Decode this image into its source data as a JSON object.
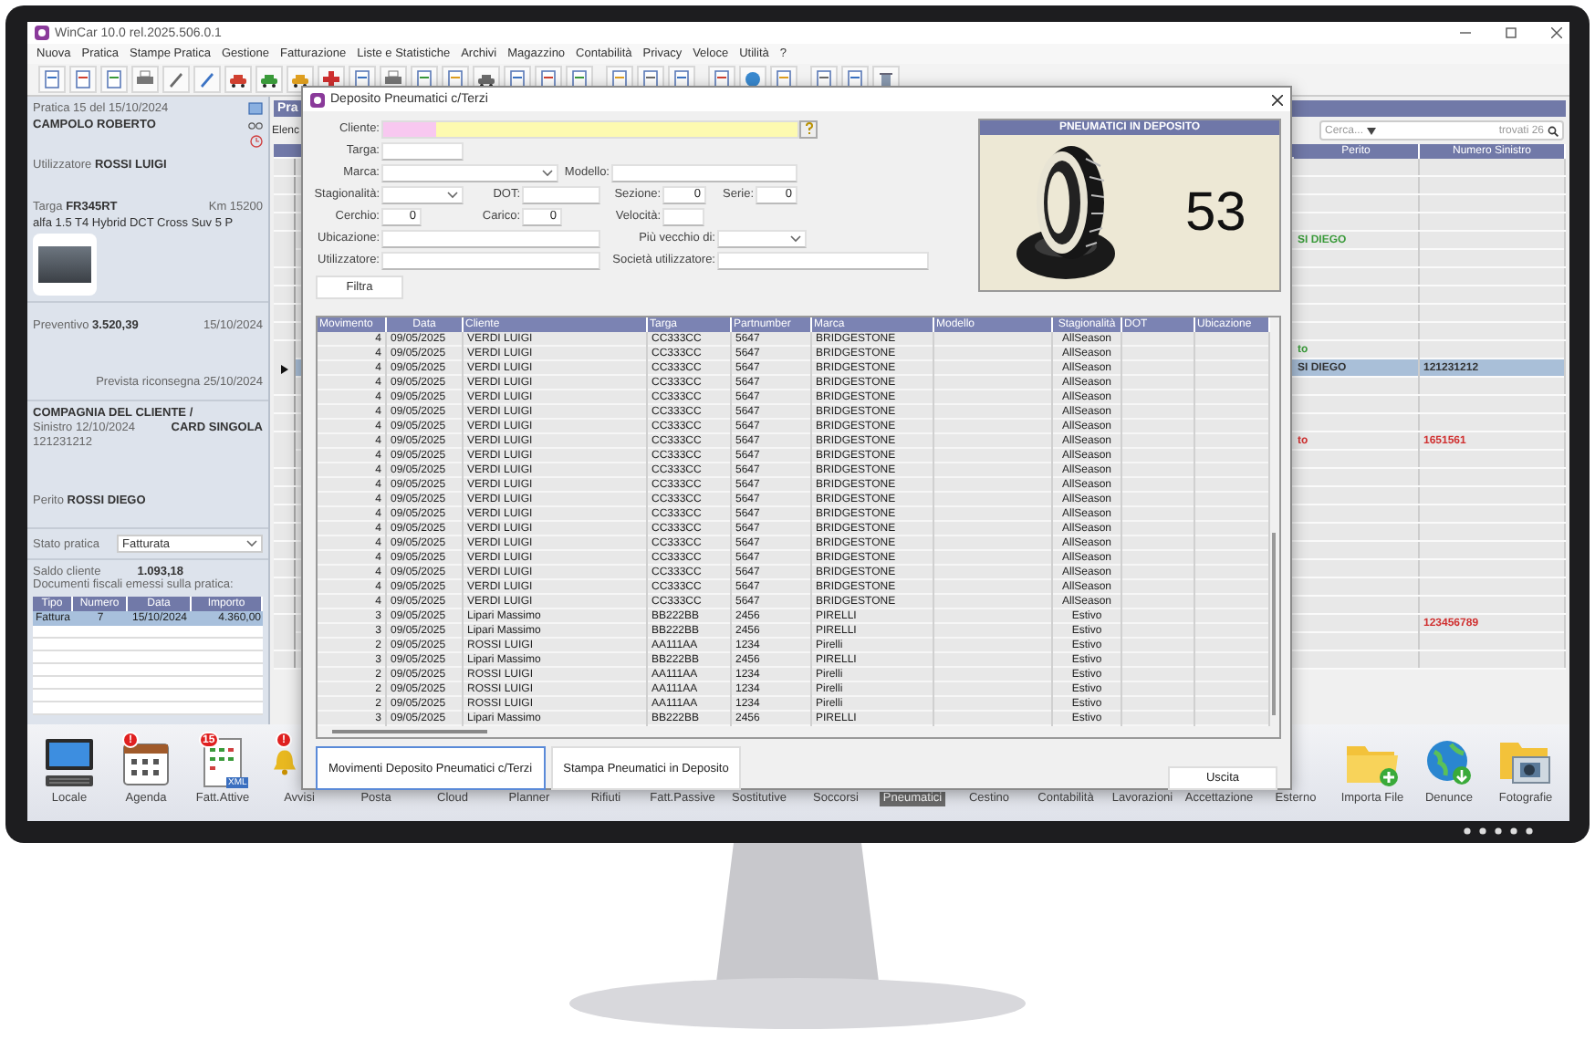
{
  "app": {
    "title": "WinCar 10.0 rel.2025.506.0.1",
    "menu": [
      "Nuova",
      "Pratica",
      "Stampe Pratica",
      "Gestione",
      "Fatturazione",
      "Liste e Statistiche",
      "Archivi",
      "Magazzino",
      "Contabilità",
      "Privacy",
      "Veloce",
      "Utilità",
      "?"
    ]
  },
  "practice_panel": {
    "header": "Pratica 15 del 15/10/2024",
    "customer": "CAMPOLO ROBERTO",
    "user": "Utilizzatore **ROSSI LUIGI**",
    "plate": "Targa **FR345RT**",
    "km": "Km 15200",
    "vehicle": "alfa 1.5 T4 Hybrid DCT Cross Suv 5 P",
    "estimate": "Preventivo **3.520,39**",
    "estimate_date": "15/10/2024",
    "delivery": "Prevista riconsegna 25/10/2024",
    "insurer": "COMPAGNIA DEL CLIENTE /",
    "claim": "Sinistro 12/10/2024",
    "claim_type": "CARD SINGOLA",
    "claim_number": "121231212",
    "assessor": "Perito **ROSSI DIEGO**",
    "status_label": "Stato pratica",
    "status_value": "Fatturata",
    "balance_label": "Saldo cliente",
    "balance": "1.093,18",
    "documents_title": "Documenti fiscali emessi sulla pratica:",
    "documents": {
      "columns": [
        "Tipo",
        "Numero",
        "Data",
        "Importo"
      ],
      "rows": [
        {
          "cells": [
            "Fattura",
            "7",
            "15/10/2024",
            "4.360,00"
          ],
          "selected": true
        }
      ]
    }
  },
  "list_panel": {
    "title": "Pra",
    "tab": "Elenc",
    "search": {
      "placeholder": "Cerca...",
      "count": "trovati 26"
    },
    "columns": [
      "Perito",
      "Numero Sinistro"
    ],
    "rows": [
      {
        "selected": false
      },
      {
        "selected": false
      },
      {
        "selected": false
      },
      {
        "selected": false
      },
      {
        "selected": false,
        "perito": "SI DIEGO",
        "color": "#3a9a3a"
      },
      {
        "selected": false
      },
      {
        "selected": false
      },
      {
        "selected": false
      },
      {
        "selected": false
      },
      {
        "selected": false
      },
      {
        "selected": false,
        "perito": "to",
        "color": "#3a9a3a"
      },
      {
        "selected": true,
        "perito": "SI DIEGO",
        "numero_sinistro": "121231212"
      },
      {
        "selected": false
      },
      {
        "selected": false
      },
      {
        "selected": false
      },
      {
        "selected": false,
        "perito": "to",
        "numero_sinistro": "1651561",
        "color": "#d03030"
      },
      {
        "selected": false
      },
      {
        "selected": false
      },
      {
        "selected": false
      },
      {
        "selected": false
      },
      {
        "selected": false
      },
      {
        "selected": false
      },
      {
        "selected": false
      },
      {
        "selected": false
      },
      {
        "selected": false
      },
      {
        "selected": false,
        "numero_sinistro": "123456789",
        "color": "#d03030"
      },
      {
        "selected": false
      },
      {
        "selected": false
      }
    ]
  },
  "dialog": {
    "title": "Deposito Pneumatici c/Terzi",
    "filters": [
      [
        {
          "label": "Cliente:",
          "kind": "lookup"
        }
      ],
      [
        {
          "label": "Targa:",
          "kind": "text"
        }
      ],
      [
        {
          "label": "Marca:",
          "kind": "select"
        },
        {
          "label": "Modello:",
          "kind": "text"
        }
      ],
      [
        {
          "label": "Stagionalità:",
          "kind": "select"
        },
        {
          "label": "DOT:",
          "kind": "text"
        },
        {
          "label": "Sezione:",
          "kind": "number",
          "value": "0"
        },
        {
          "label": "Serie:",
          "kind": "number",
          "value": "0"
        }
      ],
      [
        {
          "label": "Cerchio:",
          "kind": "number",
          "value": "0"
        },
        {
          "label": "Carico:",
          "kind": "number",
          "value": "0"
        },
        {
          "label": "Velocità:",
          "kind": "text"
        }
      ],
      [
        {
          "label": "Ubicazione:",
          "kind": "text"
        },
        {
          "label": "Più vecchio di:",
          "kind": "select"
        }
      ],
      [
        {
          "label": "Utilizzatore:",
          "kind": "text"
        },
        {
          "label": "Società utilizzatore:",
          "kind": "text"
        }
      ]
    ],
    "filter_button": "Filtra",
    "stock": {
      "title": "PNEUMATICI IN DEPOSITO",
      "count": "53"
    },
    "table": {
      "columns": [
        "Movimento",
        "Data",
        "Cliente",
        "Targa",
        "Partnumber",
        "Marca",
        "Modello",
        "Stagionalità",
        "DOT",
        "Ubicazione"
      ],
      "rows": [
        {
          "movimento": "4",
          "data": "09/05/2025",
          "cliente": "VERDI LUIGI",
          "targa": "CC333CC",
          "partnumber": "5647",
          "marca": "BRIDGESTONE",
          "stagionalita": "AllSeason"
        },
        {
          "movimento": "4",
          "data": "09/05/2025",
          "cliente": "VERDI LUIGI",
          "targa": "CC333CC",
          "partnumber": "5647",
          "marca": "BRIDGESTONE",
          "stagionalita": "AllSeason"
        },
        {
          "movimento": "4",
          "data": "09/05/2025",
          "cliente": "VERDI LUIGI",
          "targa": "CC333CC",
          "partnumber": "5647",
          "marca": "BRIDGESTONE",
          "stagionalita": "AllSeason"
        },
        {
          "movimento": "4",
          "data": "09/05/2025",
          "cliente": "VERDI LUIGI",
          "targa": "CC333CC",
          "partnumber": "5647",
          "marca": "BRIDGESTONE",
          "stagionalita": "AllSeason"
        },
        {
          "movimento": "4",
          "data": "09/05/2025",
          "cliente": "VERDI LUIGI",
          "targa": "CC333CC",
          "partnumber": "5647",
          "marca": "BRIDGESTONE",
          "stagionalita": "AllSeason"
        },
        {
          "movimento": "4",
          "data": "09/05/2025",
          "cliente": "VERDI LUIGI",
          "targa": "CC333CC",
          "partnumber": "5647",
          "marca": "BRIDGESTONE",
          "stagionalita": "AllSeason"
        },
        {
          "movimento": "4",
          "data": "09/05/2025",
          "cliente": "VERDI LUIGI",
          "targa": "CC333CC",
          "partnumber": "5647",
          "marca": "BRIDGESTONE",
          "stagionalita": "AllSeason"
        },
        {
          "movimento": "4",
          "data": "09/05/2025",
          "cliente": "VERDI LUIGI",
          "targa": "CC333CC",
          "partnumber": "5647",
          "marca": "BRIDGESTONE",
          "stagionalita": "AllSeason"
        },
        {
          "movimento": "4",
          "data": "09/05/2025",
          "cliente": "VERDI LUIGI",
          "targa": "CC333CC",
          "partnumber": "5647",
          "marca": "BRIDGESTONE",
          "stagionalita": "AllSeason"
        },
        {
          "movimento": "4",
          "data": "09/05/2025",
          "cliente": "VERDI LUIGI",
          "targa": "CC333CC",
          "partnumber": "5647",
          "marca": "BRIDGESTONE",
          "stagionalita": "AllSeason"
        },
        {
          "movimento": "4",
          "data": "09/05/2025",
          "cliente": "VERDI LUIGI",
          "targa": "CC333CC",
          "partnumber": "5647",
          "marca": "BRIDGESTONE",
          "stagionalita": "AllSeason"
        },
        {
          "movimento": "4",
          "data": "09/05/2025",
          "cliente": "VERDI LUIGI",
          "targa": "CC333CC",
          "partnumber": "5647",
          "marca": "BRIDGESTONE",
          "stagionalita": "AllSeason"
        },
        {
          "movimento": "4",
          "data": "09/05/2025",
          "cliente": "VERDI LUIGI",
          "targa": "CC333CC",
          "partnumber": "5647",
          "marca": "BRIDGESTONE",
          "stagionalita": "AllSeason"
        },
        {
          "movimento": "4",
          "data": "09/05/2025",
          "cliente": "VERDI LUIGI",
          "targa": "CC333CC",
          "partnumber": "5647",
          "marca": "BRIDGESTONE",
          "stagionalita": "AllSeason"
        },
        {
          "movimento": "4",
          "data": "09/05/2025",
          "cliente": "VERDI LUIGI",
          "targa": "CC333CC",
          "partnumber": "5647",
          "marca": "BRIDGESTONE",
          "stagionalita": "AllSeason"
        },
        {
          "movimento": "4",
          "data": "09/05/2025",
          "cliente": "VERDI LUIGI",
          "targa": "CC333CC",
          "partnumber": "5647",
          "marca": "BRIDGESTONE",
          "stagionalita": "AllSeason"
        },
        {
          "movimento": "4",
          "data": "09/05/2025",
          "cliente": "VERDI LUIGI",
          "targa": "CC333CC",
          "partnumber": "5647",
          "marca": "BRIDGESTONE",
          "stagionalita": "AllSeason"
        },
        {
          "movimento": "4",
          "data": "09/05/2025",
          "cliente": "VERDI LUIGI",
          "targa": "CC333CC",
          "partnumber": "5647",
          "marca": "BRIDGESTONE",
          "stagionalita": "AllSeason"
        },
        {
          "movimento": "4",
          "data": "09/05/2025",
          "cliente": "VERDI LUIGI",
          "targa": "CC333CC",
          "partnumber": "5647",
          "marca": "BRIDGESTONE",
          "stagionalita": "AllSeason"
        },
        {
          "movimento": "3",
          "data": "09/05/2025",
          "cliente": "Lipari Massimo",
          "targa": "BB222BB",
          "partnumber": "2456",
          "marca": "PIRELLI",
          "stagionalita": "Estivo"
        },
        {
          "movimento": "3",
          "data": "09/05/2025",
          "cliente": "Lipari Massimo",
          "targa": "BB222BB",
          "partnumber": "2456",
          "marca": "PIRELLI",
          "stagionalita": "Estivo"
        },
        {
          "movimento": "2",
          "data": "09/05/2025",
          "cliente": "ROSSI LUIGI",
          "targa": "AA111AA",
          "partnumber": "1234",
          "marca": "Pirelli",
          "stagionalita": "Estivo"
        },
        {
          "movimento": "3",
          "data": "09/05/2025",
          "cliente": "Lipari Massimo",
          "targa": "BB222BB",
          "partnumber": "2456",
          "marca": "PIRELLI",
          "stagionalita": "Estivo"
        },
        {
          "movimento": "2",
          "data": "09/05/2025",
          "cliente": "ROSSI LUIGI",
          "targa": "AA111AA",
          "partnumber": "1234",
          "marca": "Pirelli",
          "stagionalita": "Estivo"
        },
        {
          "movimento": "2",
          "data": "09/05/2025",
          "cliente": "ROSSI LUIGI",
          "targa": "AA111AA",
          "partnumber": "1234",
          "marca": "Pirelli",
          "stagionalita": "Estivo"
        },
        {
          "movimento": "2",
          "data": "09/05/2025",
          "cliente": "ROSSI LUIGI",
          "targa": "AA111AA",
          "partnumber": "1234",
          "marca": "Pirelli",
          "stagionalita": "Estivo"
        },
        {
          "movimento": "3",
          "data": "09/05/2025",
          "cliente": "Lipari Massimo",
          "targa": "BB222BB",
          "partnumber": "2456",
          "marca": "PIRELLI",
          "stagionalita": "Estivo"
        }
      ]
    },
    "buttons": [
      {
        "label": "Movimenti Deposito Pneumatici c/Terzi",
        "selected": true
      },
      {
        "label": "Stampa Pneumatici in Deposito",
        "selected": false
      }
    ],
    "exit_button": "Uscita"
  },
  "taskbar": [
    {
      "label": "Locale",
      "selected": false
    },
    {
      "label": "Agenda",
      "selected": false,
      "badge": "!"
    },
    {
      "label": "Fatt.Attive",
      "selected": false,
      "badge": "15",
      "icon_text": "XML"
    },
    {
      "label": "Avvisi",
      "selected": false,
      "badge": "!"
    },
    {
      "label": "Posta",
      "selected": false
    },
    {
      "label": "Cloud",
      "selected": false
    },
    {
      "label": "Planner",
      "selected": false
    },
    {
      "label": "Rifiuti",
      "selected": false
    },
    {
      "label": "Fatt.Passive",
      "selected": false
    },
    {
      "label": "Sostitutive",
      "selected": false
    },
    {
      "label": "Soccorsi",
      "selected": false
    },
    {
      "label": "Pneumatici",
      "selected": true
    },
    {
      "label": "Cestino",
      "selected": false
    },
    {
      "label": "Contabilità",
      "selected": false
    },
    {
      "label": "Lavorazioni",
      "selected": false
    },
    {
      "label": "Accettazione",
      "selected": false
    },
    {
      "label": "Esterno",
      "selected": false
    },
    {
      "label": "Importa File",
      "selected": false
    },
    {
      "label": "Denunce",
      "selected": false
    },
    {
      "label": "Fotografie",
      "selected": false
    }
  ]
}
